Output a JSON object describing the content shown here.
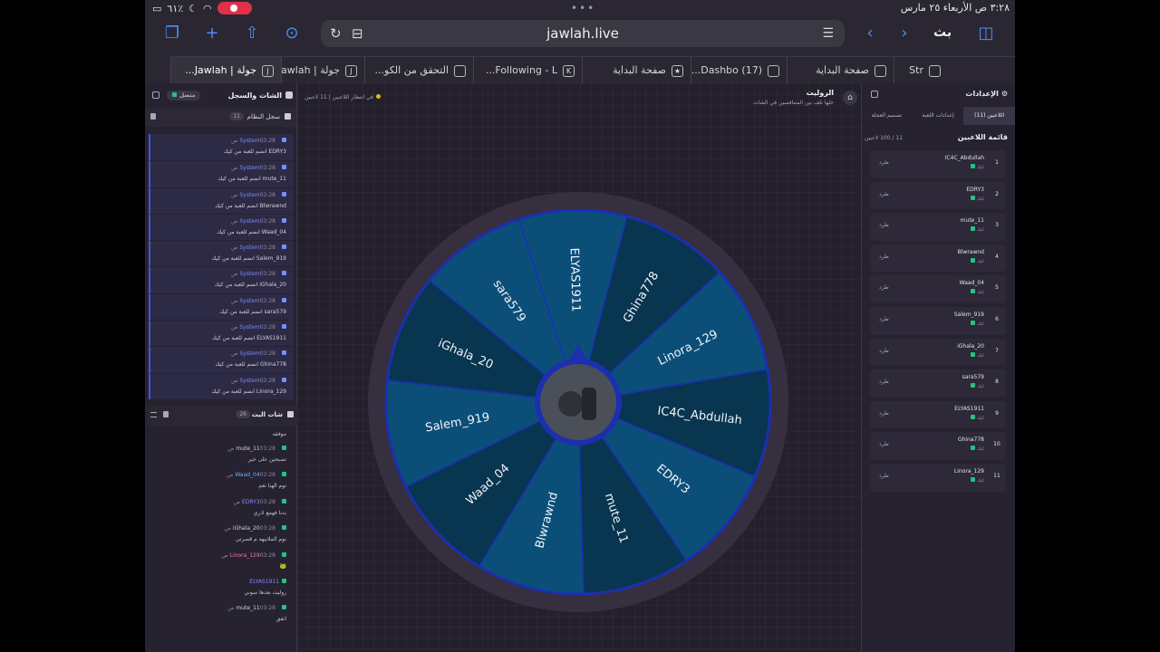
{
  "status": {
    "time_date": "٣:٢٨ ص  الأربعاء ٢٥ مارس",
    "battery": "٦١٪"
  },
  "browser": {
    "url": "jawlah.live",
    "search_label": "بث",
    "tabs": [
      {
        "label": "جولة | Jawlah...",
        "active": true,
        "fav": "J"
      },
      {
        "label": "جولة | Jawlah...",
        "fav": "J"
      },
      {
        "label": "التحقق من الكو...",
        "fav": ""
      },
      {
        "label": "Following - L...",
        "fav": "K"
      },
      {
        "label": "صفحة البداية",
        "fav": "★"
      },
      {
        "label": "(17) Dashbo...",
        "fav": ""
      },
      {
        "label": "صفحة البداية",
        "fav": ""
      },
      {
        "label": "Str",
        "fav": ""
      }
    ]
  },
  "left": {
    "title": "الشات والسجل",
    "connected": "متصل",
    "syslog": {
      "title": "سجل النظام",
      "count": "11",
      "entries": [
        {
          "who": "System",
          "time": "03:28 ص",
          "msg": "EDRY3 انضم للعبة من كيك"
        },
        {
          "who": "System",
          "time": "03:28 ص",
          "msg": "mute_11 انضم للعبة من كيك"
        },
        {
          "who": "System",
          "time": "03:28 ص",
          "msg": "Blwrawnd انضم للعبة من كيك"
        },
        {
          "who": "System",
          "time": "03:28 ص",
          "msg": "Waad_04 انضم للعبة من كيك"
        },
        {
          "who": "System",
          "time": "03:28 ص",
          "msg": "Salem_919 انضم للعبة من كيك"
        },
        {
          "who": "System",
          "time": "03:28 ص",
          "msg": "iGhala_20 انضم للعبة من كيك"
        },
        {
          "who": "System",
          "time": "03:28 ص",
          "msg": "sara579 انضم للعبة من كيك"
        },
        {
          "who": "System",
          "time": "03:28 ص",
          "msg": "ELYAS1911 انضم للعبة من كيك"
        },
        {
          "who": "System",
          "time": "03:28 ص",
          "msg": "Ghina778 انضم للعبة من كيك"
        },
        {
          "who": "System",
          "time": "03:28 ص",
          "msg": "Linora_129 انضم للعبة من كيك"
        }
      ]
    },
    "chat": {
      "title": "شات البث",
      "count": "26",
      "first": "موفقه",
      "messages": [
        {
          "user": "mute_11",
          "time": "03:28 ص",
          "text": "تصبحين على خير",
          "color": "#d8d5e0"
        },
        {
          "user": "Waad_04",
          "time": "03:28 ص",
          "text": "نوم الهنا نعم",
          "color": "#5ab4ff"
        },
        {
          "user": "EDRY3",
          "time": "03:28 ص",
          "text": "بدنا فهمع اذري",
          "color": "#7e8cff"
        },
        {
          "user": "iGhala_20",
          "time": "03:28 ص",
          "text": "نوم الملابيهه م قصرتي",
          "color": "#d8d5e0"
        },
        {
          "user": "Linora_129",
          "time": "03:28 ص",
          "text": "🐸",
          "color": "#ff6fa0"
        },
        {
          "user": "ELYAS1911",
          "time": "",
          "text": "روليت بعدها سوني",
          "color": "#7e8cff"
        },
        {
          "user": "mute_11",
          "time": "03:28 ص",
          "text": "اتفق",
          "color": "#d8d5e0"
        }
      ]
    }
  },
  "center": {
    "title": "الروليت",
    "subtitle": "خلها تلف بين المتنافسين في الشات",
    "status": "في انتظار اللاعبين  |  11 لاعبين",
    "wheel": {
      "names": [
        "ELYAS1911",
        "Ghina778",
        "Linora_129",
        "IC4C_Abdullah",
        "EDRY3",
        "mute_11",
        "Blwrawnd",
        "Waad_04",
        "Salem_919",
        "iGhala_20",
        "sara579"
      ],
      "colors": [
        "#0b4f79",
        "#083550"
      ]
    }
  },
  "right": {
    "title": "الإعدادات",
    "tabs": [
      "اللاعبين (11)",
      "إعدادات اللعبة",
      "تصميم العجلة"
    ],
    "list_title": "قائمة اللاعبين",
    "list_count": "11 / 100 لاعبين",
    "kick": "طرد",
    "players": [
      {
        "n": "1",
        "name": "IC4C_Abdullah",
        "status": "كيك"
      },
      {
        "n": "2",
        "name": "EDRY3",
        "status": "كيك"
      },
      {
        "n": "3",
        "name": "mute_11",
        "status": "كيك"
      },
      {
        "n": "4",
        "name": "Blwrawnd",
        "status": "كيك"
      },
      {
        "n": "5",
        "name": "Waad_04",
        "status": "كيك"
      },
      {
        "n": "6",
        "name": "Salem_919",
        "status": "كيك"
      },
      {
        "n": "7",
        "name": "iGhala_20",
        "status": "كيك"
      },
      {
        "n": "8",
        "name": "sara579",
        "status": "كيك"
      },
      {
        "n": "9",
        "name": "ELYAS1911",
        "status": "كيك"
      },
      {
        "n": "10",
        "name": "Ghina778",
        "status": "كيك"
      },
      {
        "n": "11",
        "name": "Linora_129",
        "status": "كيك"
      }
    ]
  }
}
